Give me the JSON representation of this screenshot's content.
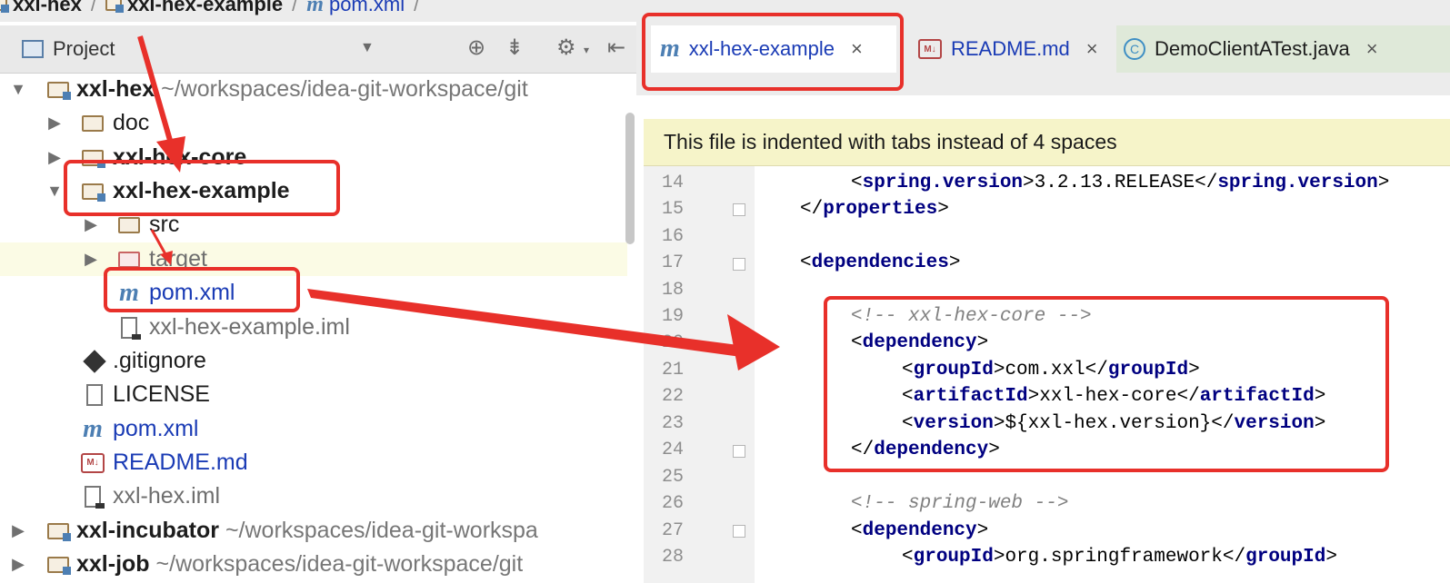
{
  "breadcrumb": [
    "xxl-hex",
    "xxl-hex-example",
    "pom.xml"
  ],
  "project_panel": {
    "title": "Project"
  },
  "tree": [
    {
      "label": "xxl-hex",
      "path": "~/workspaces/idea-git-workspace/git"
    },
    {
      "label": "doc"
    },
    {
      "label": "xxl-hex-core"
    },
    {
      "label": "xxl-hex-example"
    },
    {
      "label": "src"
    },
    {
      "label": "target"
    },
    {
      "label": "pom.xml"
    },
    {
      "label": "xxl-hex-example.iml"
    },
    {
      "label": ".gitignore"
    },
    {
      "label": "LICENSE"
    },
    {
      "label": "pom.xml"
    },
    {
      "label": "README.md"
    },
    {
      "label": "xxl-hex.iml"
    },
    {
      "label": "xxl-incubator",
      "path": "~/workspaces/idea-git-workspa"
    },
    {
      "label": "xxl-job",
      "path": "~/workspaces/idea-git-workspace/git"
    }
  ],
  "tabs": [
    {
      "label": "xxl-hex-example",
      "close": "×"
    },
    {
      "label": "README.md",
      "close": "×"
    },
    {
      "label": "DemoClientATest.java",
      "close": "×"
    }
  ],
  "banner": "This file is indented with tabs instead of 4 spaces",
  "line_numbers": [
    "14",
    "15",
    "16",
    "17",
    "18",
    "19",
    "20",
    "21",
    "22",
    "23",
    "24",
    "25",
    "26",
    "27",
    "28"
  ],
  "code": {
    "l14": {
      "t1": "spring.version",
      "v": "3.2.13.RELEASE",
      "t2": "spring.version"
    },
    "l15": {
      "t": "properties"
    },
    "l17": {
      "t": "dependencies"
    },
    "l19": "<!-- xxl-hex-core -->",
    "l20": {
      "t": "dependency"
    },
    "l21": {
      "t": "groupId",
      "v": "com.xxl"
    },
    "l22": {
      "t": "artifactId",
      "v": "xxl-hex-core"
    },
    "l23": {
      "t": "version",
      "v": "${xxl-hex.version}"
    },
    "l24": {
      "t": "dependency"
    },
    "l26": "<!-- spring-web -->",
    "l27": {
      "t": "dependency"
    },
    "l28": {
      "t": "groupId",
      "v": "org.springframework"
    }
  },
  "colors": {
    "annotation_red": "#e8302a",
    "tag_navy": "#000080",
    "link_blue": "#1a3bb5",
    "banner_yellow": "#f6f4c9"
  }
}
